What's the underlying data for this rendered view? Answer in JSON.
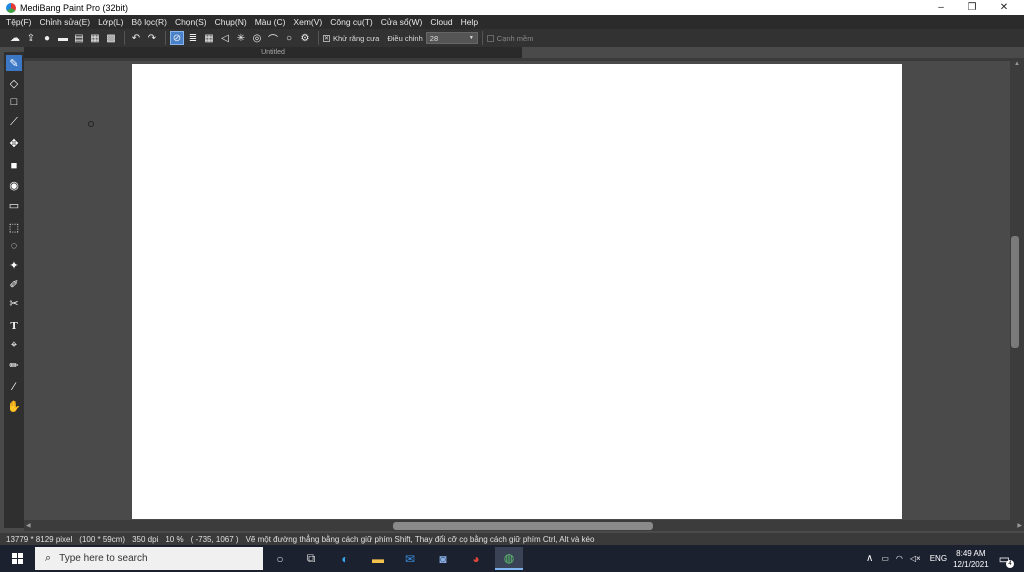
{
  "window": {
    "title": "MediBang Paint Pro (32bit)",
    "min": "–",
    "max": "❐",
    "close": "✕"
  },
  "menu": [
    "Tệp(F)",
    "Chỉnh sửa(E)",
    "Lớp(L)",
    "Bộ lọc(R)",
    "Chọn(S)",
    "Chụp(N)",
    "Màu (C)",
    "Xem(V)",
    "Công cụ(T)",
    "Cửa sổ(W)",
    "Cloud",
    "Help"
  ],
  "toolbar": {
    "antialias_label": "Khử răng cưa",
    "adjust_label": "Điều chỉnh",
    "adjust_value": "28",
    "soft_label": "Cạnh mềm"
  },
  "document": {
    "tab_title": "Untitled"
  },
  "status": {
    "size": "13779 * 8129 pixel",
    "physical": "(100 * 59cm)",
    "dpi": "350 dpi",
    "zoom": "10 %",
    "coords": "( -735, 1067 )",
    "hint": "Vẽ một đường thẳng bằng cách giữ phím Shift, Thay đổi cỡ cọ bằng cách giữ phím Ctrl, Alt và kéo"
  },
  "taskbar": {
    "search_placeholder": "Type here to search",
    "lang": "ENG",
    "time": "8:49 AM",
    "date": "12/1/2021",
    "notif_count": "4"
  }
}
